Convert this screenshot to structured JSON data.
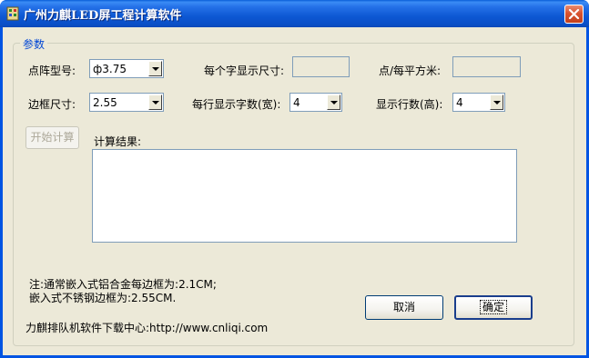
{
  "window": {
    "title": "广州力麒LED屏工程计算软件"
  },
  "group": {
    "label": "参数"
  },
  "form": {
    "pitch_label": "点阵型号:",
    "pitch_value": "ф3.75",
    "char_size_label": "每个字显示尺寸:",
    "char_size_value": "",
    "dot_density_label": "点/每平方米:",
    "dot_density_value": "",
    "border_label": "边框尺寸:",
    "border_value": "2.55",
    "chars_per_row_label": "每行显示字数(宽):",
    "chars_per_row_value": "4",
    "rows_label": "显示行数(高):",
    "rows_value": "4"
  },
  "actions": {
    "start_label": "开始计算",
    "cancel_label": "取消",
    "ok_label": "确定"
  },
  "result": {
    "label": "计算结果:",
    "value": ""
  },
  "notes": {
    "line1": "注:通常嵌入式铝合金每边框为:2.1CM;",
    "line2": "嵌入式不锈钢边框为:2.55CM.",
    "download": "力麒排队机软件下载中心:http://www.cnliqi.com"
  }
}
